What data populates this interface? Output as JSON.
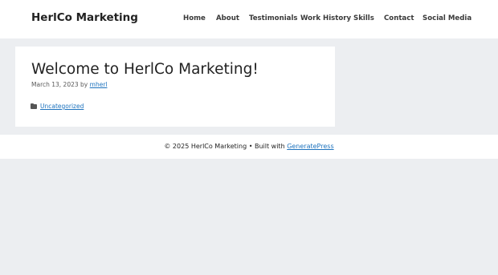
{
  "site": {
    "title": "HerlCo Marketing"
  },
  "nav": {
    "items": [
      {
        "label": "Home"
      },
      {
        "label": "About"
      },
      {
        "label": "Testimonials"
      },
      {
        "label": "Work History"
      },
      {
        "label": "Skills"
      },
      {
        "label": "Contact"
      },
      {
        "label": "Social Media"
      }
    ]
  },
  "post": {
    "title": "Welcome to HerlCo Marketing!",
    "date": "March 13, 2023",
    "by_label": "by",
    "author": "mherl",
    "category": "Uncategorized",
    "category_icon": "folder-icon"
  },
  "footer": {
    "copyright": "© 2025 HerlCo Marketing • Built with",
    "builder_link": "GeneratePress"
  },
  "colors": {
    "page_background": "#eceef1",
    "link": "#1e73be",
    "text": "#222222"
  }
}
